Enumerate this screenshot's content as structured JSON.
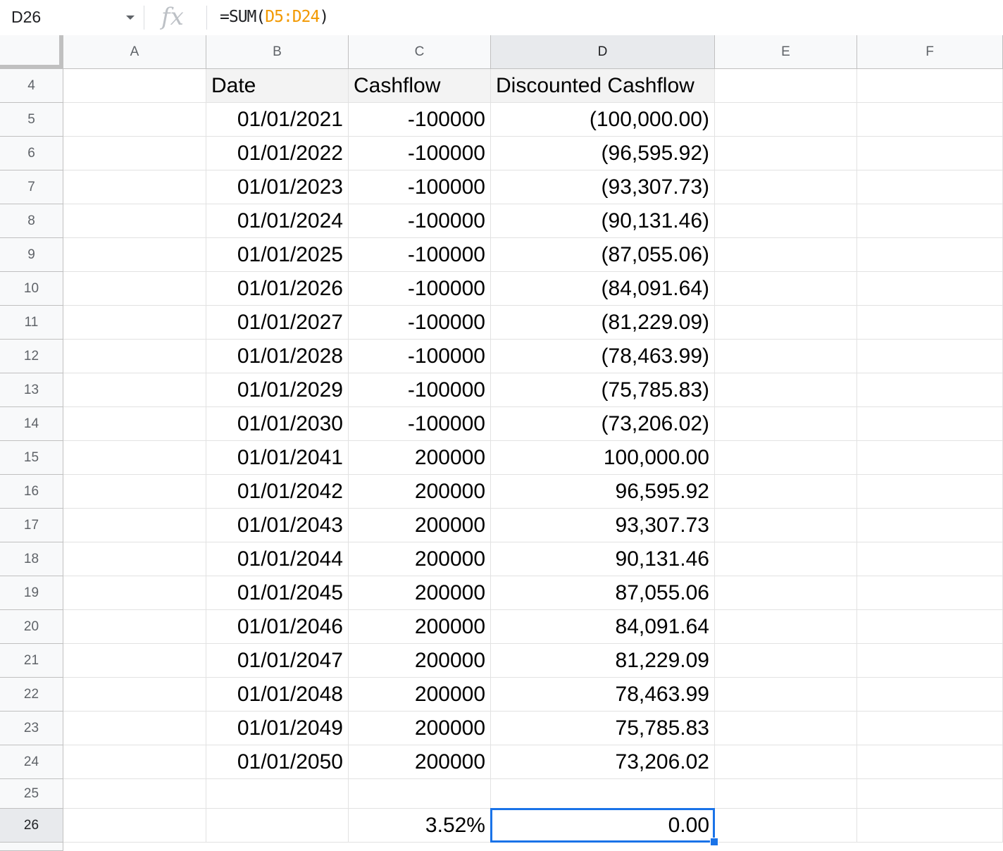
{
  "formula_bar": {
    "name_box": "D26",
    "fx_label": "fx",
    "formula_prefix": "=SUM(",
    "formula_range": "D5:D24",
    "formula_suffix": ")"
  },
  "columns": [
    "A",
    "B",
    "C",
    "D",
    "E",
    "F"
  ],
  "selected_column": "D",
  "selected_row": "26",
  "header_row": {
    "row": "4",
    "b": "Date",
    "c": "Cashflow",
    "d": "Discounted Cashflow"
  },
  "rows": [
    {
      "row": "5",
      "date": "01/01/2021",
      "cashflow": "-100000",
      "discounted": "(100,000.00)"
    },
    {
      "row": "6",
      "date": "01/01/2022",
      "cashflow": "-100000",
      "discounted": "(96,595.92)"
    },
    {
      "row": "7",
      "date": "01/01/2023",
      "cashflow": "-100000",
      "discounted": "(93,307.73)"
    },
    {
      "row": "8",
      "date": "01/01/2024",
      "cashflow": "-100000",
      "discounted": "(90,131.46)"
    },
    {
      "row": "9",
      "date": "01/01/2025",
      "cashflow": "-100000",
      "discounted": "(87,055.06)"
    },
    {
      "row": "10",
      "date": "01/01/2026",
      "cashflow": "-100000",
      "discounted": "(84,091.64)"
    },
    {
      "row": "11",
      "date": "01/01/2027",
      "cashflow": "-100000",
      "discounted": "(81,229.09)"
    },
    {
      "row": "12",
      "date": "01/01/2028",
      "cashflow": "-100000",
      "discounted": "(78,463.99)"
    },
    {
      "row": "13",
      "date": "01/01/2029",
      "cashflow": "-100000",
      "discounted": "(75,785.83)"
    },
    {
      "row": "14",
      "date": "01/01/2030",
      "cashflow": "-100000",
      "discounted": "(73,206.02)"
    },
    {
      "row": "15",
      "date": "01/01/2041",
      "cashflow": "200000",
      "discounted": "100,000.00"
    },
    {
      "row": "16",
      "date": "01/01/2042",
      "cashflow": "200000",
      "discounted": "96,595.92"
    },
    {
      "row": "17",
      "date": "01/01/2043",
      "cashflow": "200000",
      "discounted": "93,307.73"
    },
    {
      "row": "18",
      "date": "01/01/2044",
      "cashflow": "200000",
      "discounted": "90,131.46"
    },
    {
      "row": "19",
      "date": "01/01/2045",
      "cashflow": "200000",
      "discounted": "87,055.06"
    },
    {
      "row": "20",
      "date": "01/01/2046",
      "cashflow": "200000",
      "discounted": "84,091.64"
    },
    {
      "row": "21",
      "date": "01/01/2047",
      "cashflow": "200000",
      "discounted": "81,229.09"
    },
    {
      "row": "22",
      "date": "01/01/2048",
      "cashflow": "200000",
      "discounted": "78,463.99"
    },
    {
      "row": "23",
      "date": "01/01/2049",
      "cashflow": "200000",
      "discounted": "75,785.83"
    },
    {
      "row": "24",
      "date": "01/01/2050",
      "cashflow": "200000",
      "discounted": "73,206.02"
    }
  ],
  "blank_row": {
    "row": "25"
  },
  "result_row": {
    "row": "26",
    "rate": "3.52%",
    "total": "0.00"
  },
  "colors": {
    "selection": "#1a73e8",
    "formula_range": "#f29900"
  }
}
